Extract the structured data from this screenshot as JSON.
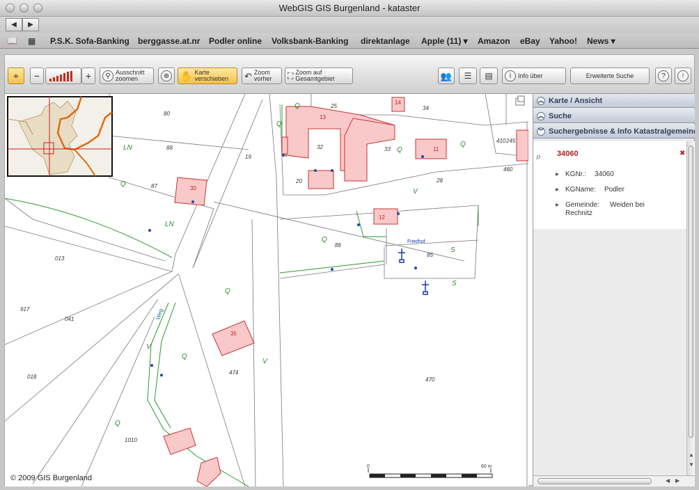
{
  "window": {
    "title": "WebGIS GIS Burgenland - kataster"
  },
  "bookmarks": [
    "P.S.K. Sofa-Banking",
    "berggasse.at.nr",
    "Podler online",
    "Volksbank-Banking",
    "direktanlage",
    "Apple (11) ▾",
    "Amazon",
    "eBay",
    "Yahoo!",
    "News ▾"
  ],
  "toolbar": {
    "minus": "−",
    "plus": "+",
    "ausschnitt": [
      "Ausschnitt",
      "zoomen"
    ],
    "verschieben": [
      "Karte",
      "verschieben"
    ],
    "zoom_vorher": [
      "Zoom",
      "vorher"
    ],
    "zoom_gesamt": [
      "Zoom auf",
      "Gesamtgebiet"
    ],
    "info_label": "Info über",
    "search_label": "Erweiterte Suche",
    "help_label": "?",
    "info_icon_label": "i"
  },
  "map": {
    "copyright": "© 2009 GIS Burgenland",
    "scale": {
      "start": "0",
      "end": "60 m"
    },
    "parcel_numbers": [
      "80",
      "88",
      "87",
      "19",
      "25",
      "34",
      "32",
      "33",
      "20",
      "28",
      "460",
      "245",
      "410",
      "86",
      "85",
      "470",
      "474",
      "1010",
      "013",
      "917",
      "041",
      "018"
    ],
    "building_numbers": [
      "13",
      "14",
      "11",
      "30",
      "12",
      "35"
    ],
    "labels": {
      "friedhof": "Friedhof",
      "weg": "Weg"
    },
    "land_use": [
      "Q",
      "LN",
      "V",
      "S"
    ]
  },
  "panel": {
    "sections": [
      "Karte / Ansicht",
      "Suche",
      "Suchergebnisse & Info Katastralgemeinde"
    ],
    "result_id": "34060",
    "rows": [
      {
        "label": "KGNr.:",
        "value": "34060"
      },
      {
        "label": "KGName:",
        "value": "Podler"
      },
      {
        "label": "Gemeinde:",
        "value": "Weiden bei Rechnitz"
      }
    ]
  },
  "colors": {
    "building_fill": "#f9c9c9",
    "building_stroke": "#c83232",
    "green_line": "#2a9a2a",
    "orange_boundary": "#e06a12"
  }
}
